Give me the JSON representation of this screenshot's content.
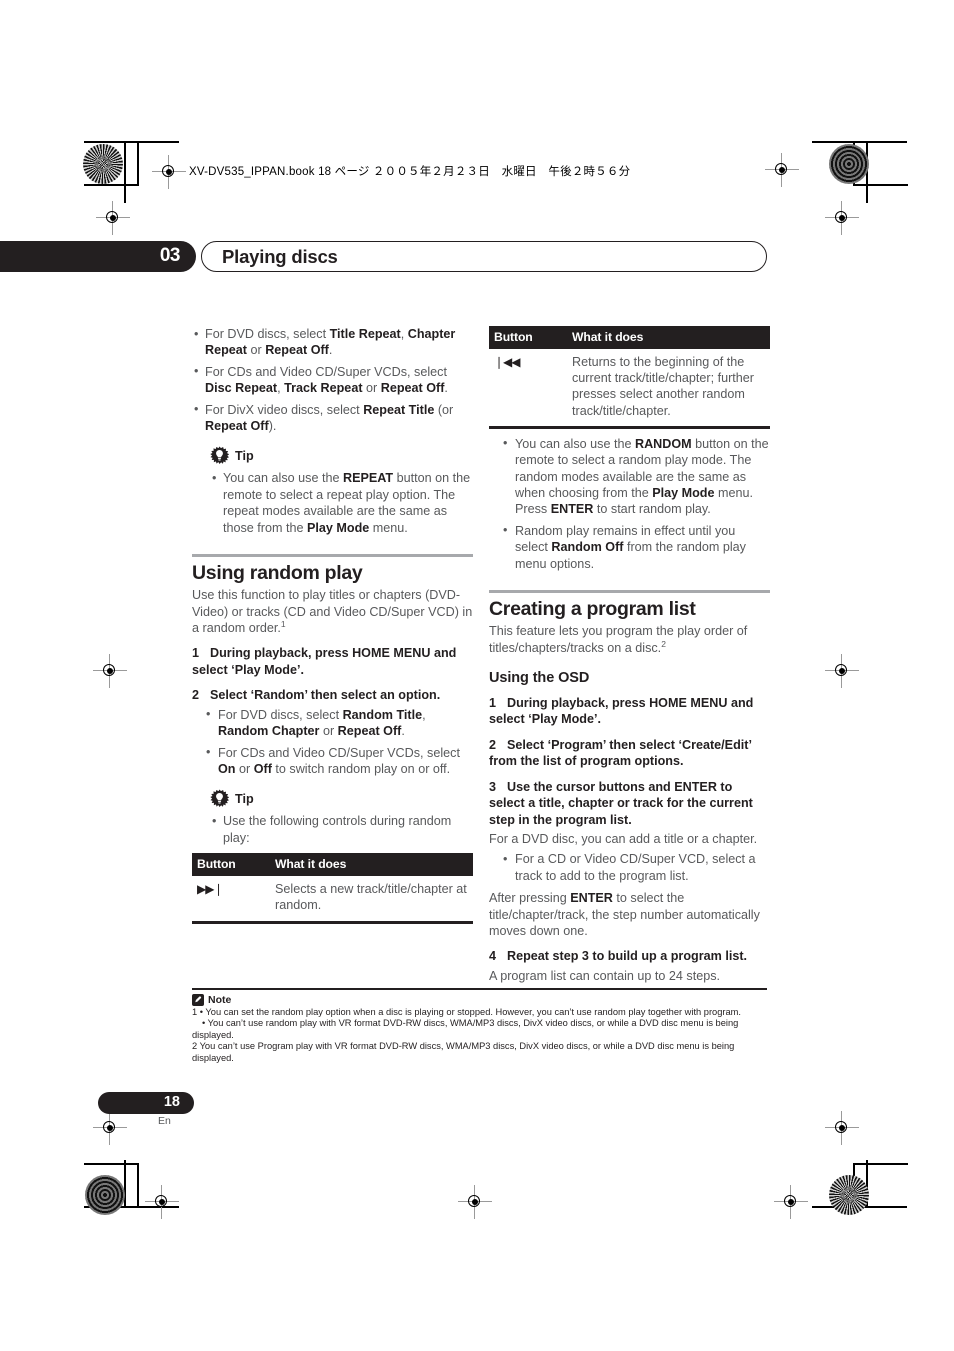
{
  "print_marks": {
    "book_header": "XV-DV535_IPPAN.book 18 ページ ２００５年２月２３日　水曜日　午後２時５６分"
  },
  "chapter": {
    "number": "03",
    "title": "Playing discs"
  },
  "left_column": {
    "repeat_options": [
      {
        "segments": [
          {
            "t": "For DVD discs, select ",
            "b": false
          },
          {
            "t": "Title Repeat",
            "b": true
          },
          {
            "t": ", ",
            "b": false
          },
          {
            "t": "Chapter Repeat",
            "b": true
          },
          {
            "t": " or ",
            "b": false
          },
          {
            "t": "Repeat Off",
            "b": true
          },
          {
            "t": ".",
            "b": false
          }
        ]
      },
      {
        "segments": [
          {
            "t": "For CDs and Video CD/Super VCDs, select ",
            "b": false
          },
          {
            "t": "Disc Repeat",
            "b": true
          },
          {
            "t": ", ",
            "b": false
          },
          {
            "t": "Track Repeat",
            "b": true
          },
          {
            "t": " or ",
            "b": false
          },
          {
            "t": "Repeat Off",
            "b": true
          },
          {
            "t": ".",
            "b": false
          }
        ]
      },
      {
        "segments": [
          {
            "t": "For DivX video discs, select ",
            "b": false
          },
          {
            "t": "Repeat Title",
            "b": true
          },
          {
            "t": " (or ",
            "b": false
          },
          {
            "t": "Repeat Off",
            "b": true
          },
          {
            "t": ").",
            "b": false
          }
        ]
      }
    ],
    "tip1": {
      "label": "Tip",
      "icon": "tip-bulb-icon",
      "bullets": [
        {
          "segments": [
            {
              "t": "You can also use the ",
              "b": false
            },
            {
              "t": "REPEAT",
              "b": true
            },
            {
              "t": " button on the remote to select a repeat play option. The repeat modes available are the same as those from the ",
              "b": false
            },
            {
              "t": "Play Mode",
              "b": true
            },
            {
              "t": " menu.",
              "b": false
            }
          ]
        }
      ]
    },
    "random_section": {
      "heading": "Using random play",
      "intro_segments": [
        {
          "t": "Use this function to play titles or chapters (DVD-Video) or tracks (CD and Video CD/Super VCD) in a random order.",
          "b": false
        }
      ],
      "intro_footnote": "1",
      "step1": {
        "num": "1",
        "text": "During playback, press HOME MENU and select ‘Play Mode’."
      },
      "step2": {
        "num": "2",
        "text": "Select ‘Random’ then select an option.",
        "bullets": [
          {
            "segments": [
              {
                "t": "For DVD discs, select ",
                "b": false
              },
              {
                "t": "Random Title",
                "b": true
              },
              {
                "t": ", ",
                "b": false
              },
              {
                "t": "Random Chapter",
                "b": true
              },
              {
                "t": " or ",
                "b": false
              },
              {
                "t": "Repeat Off",
                "b": true
              },
              {
                "t": ".",
                "b": false
              }
            ]
          },
          {
            "segments": [
              {
                "t": "For CDs and Video CD/Super VCDs, select ",
                "b": false
              },
              {
                "t": "On",
                "b": true
              },
              {
                "t": " or ",
                "b": false
              },
              {
                "t": "Off",
                "b": true
              },
              {
                "t": " to switch random play on or off.",
                "b": false
              }
            ]
          }
        ]
      },
      "tip2": {
        "label": "Tip",
        "icon": "tip-bulb-icon",
        "bullets": [
          {
            "segments": [
              {
                "t": "Use the following controls during random play:",
                "b": false
              }
            ]
          }
        ]
      },
      "table": {
        "headers": [
          "Button",
          "What it does"
        ],
        "rows": [
          {
            "button_icon": "next-track-icon",
            "button_glyph": "▶▶❘",
            "description": "Selects a new track/title/chapter at random."
          }
        ]
      }
    }
  },
  "right_column": {
    "table": {
      "headers": [
        "Button",
        "What it does"
      ],
      "rows": [
        {
          "button_icon": "previous-track-icon",
          "button_glyph": "❘◀◀",
          "description": "Returns to the beginning of the current track/title/chapter; further presses select another random track/title/chapter."
        }
      ]
    },
    "bullets": [
      {
        "segments": [
          {
            "t": "You can also use the ",
            "b": false
          },
          {
            "t": "RANDOM",
            "b": true
          },
          {
            "t": " button on the remote to select a random play mode. The random modes available are the same as when choosing from the ",
            "b": false
          },
          {
            "t": "Play Mode",
            "b": true
          },
          {
            "t": " menu. Press ",
            "b": false
          },
          {
            "t": "ENTER",
            "b": true
          },
          {
            "t": " to start random play.",
            "b": false
          }
        ]
      },
      {
        "segments": [
          {
            "t": "Random play remains in effect until you select ",
            "b": false
          },
          {
            "t": "Random Off",
            "b": true
          },
          {
            "t": " from the random play menu options.",
            "b": false
          }
        ]
      }
    ],
    "program_section": {
      "heading": "Creating a program list",
      "intro": "This feature lets you program the play order of titles/chapters/tracks on a disc.",
      "intro_footnote": "2",
      "sub_heading": "Using the OSD",
      "steps": [
        {
          "num": "1",
          "text": "During playback, press HOME MENU and select ‘Play Mode’."
        },
        {
          "num": "2",
          "text": "Select ‘Program’ then select ‘Create/Edit’ from the list of program options."
        },
        {
          "num": "3",
          "text": "Use the cursor buttons and ENTER to select a title, chapter or track for the current step in the program list."
        }
      ],
      "step3_body": "For a DVD disc, you can add a title or a chapter.",
      "step3_bullets": [
        {
          "segments": [
            {
              "t": "For a CD or Video CD/Super VCD, select a track to add to the program list.",
              "b": false
            }
          ]
        }
      ],
      "step3_after_segments": [
        {
          "t": "After pressing ",
          "b": false
        },
        {
          "t": "ENTER",
          "b": true
        },
        {
          "t": " to select the title/chapter/track, the step number automatically moves down one.",
          "b": false
        }
      ],
      "step4": {
        "num": "4",
        "text": "Repeat step 3 to build up a program list."
      },
      "step4_body": "A program list can contain up to 24 steps."
    }
  },
  "notes": {
    "label": "Note",
    "icon": "note-pen-icon",
    "lines": [
      "1 • You can set the random play option when a disc is playing or stopped. However, you can’t use random play together with program.",
      "• You can’t use random play with VR format DVD-RW discs, WMA/MP3 discs, DivX video discs, or while a DVD disc menu is being displayed.",
      "2 You can’t use Program play with VR format DVD-RW discs, WMA/MP3 discs, DivX video discs, or while a DVD disc menu is being displayed."
    ]
  },
  "footer": {
    "page_number": "18",
    "language": "En"
  },
  "colors": {
    "ink": "#231f20",
    "body_text": "#58595b",
    "rule_gray": "#a7a9ac",
    "paper": "#ffffff"
  }
}
